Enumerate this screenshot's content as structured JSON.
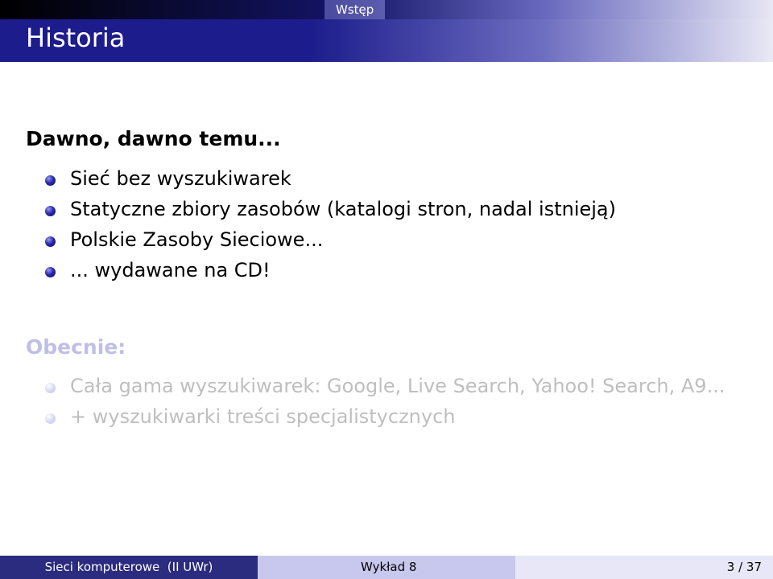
{
  "header": {
    "frame_title": "Historia",
    "section": "Wstęp"
  },
  "blocks": [
    {
      "title": "Dawno, dawno temu...",
      "items": [
        "Sieć bez wyszukiwarek",
        "Statyczne zbiory zasobów (katalogi stron, nadal istnieją)",
        "Polskie Zasoby Sieciowe...",
        "... wydawane na CD!"
      ]
    },
    {
      "title": "Obecnie:",
      "items": [
        "Cała gama wyszukiwarek: Google, Live Search, Yahoo! Search, A9...",
        "+ wyszukiwarki treści specjalistycznych"
      ]
    }
  ],
  "footer": {
    "course": "Sieci komputerowe  (II UWr)",
    "lecture": "Wykład 8",
    "page": "3 / 37"
  },
  "colors": {
    "title_bar": "#1c1c8c",
    "bullet_active": "#2b2bb0",
    "dim_text": "#bfbfbf",
    "footer_left": "#2b2b7f",
    "footer_mid": "#c8c8ee",
    "footer_right": "#e7e7f7"
  }
}
